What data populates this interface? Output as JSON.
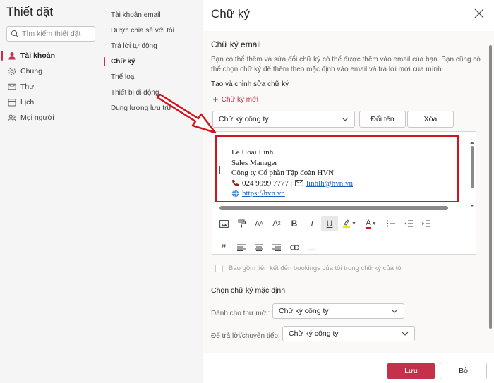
{
  "app": {
    "title": "Thiết đặt",
    "search_placeholder": "Tìm kiếm thiết đặt"
  },
  "nav": {
    "items": [
      {
        "label": "Tài khoản",
        "icon": "person-icon",
        "active": true
      },
      {
        "label": "Chung",
        "icon": "gear-icon",
        "active": false
      },
      {
        "label": "Thư",
        "icon": "mail-icon",
        "active": false
      },
      {
        "label": "Lịch",
        "icon": "calendar-icon",
        "active": false
      },
      {
        "label": "Mọi người",
        "icon": "people-icon",
        "active": false
      }
    ]
  },
  "subnav": {
    "items": [
      {
        "label": "Tài khoản email",
        "active": false
      },
      {
        "label": "Được chia sẻ với tôi",
        "active": false
      },
      {
        "label": "Trả lời tự động",
        "active": false
      },
      {
        "label": "Chữ ký",
        "active": true
      },
      {
        "label": "Thể loại",
        "active": false
      },
      {
        "label": "Thiết bị di động",
        "active": false
      },
      {
        "label": "Dung lượng lưu trữ",
        "active": false
      }
    ]
  },
  "dialog": {
    "title": "Chữ ký",
    "section_title": "Chữ ký email",
    "description": "Bạn có thể thêm và sửa đổi chữ ký có thể được thêm vào email của bạn. Bạn cũng có thể chọn chữ ký để thêm theo mặc định vào email và trả lời mới của mình.",
    "create_edit_heading": "Tạo và chỉnh sửa chữ ký",
    "new_signature_label": "Chữ ký mới",
    "selected_signature": "Chữ ký công ty",
    "rename_label": "Đổi tên",
    "delete_label": "Xóa"
  },
  "signature": {
    "name": "Lê Hoài Linh",
    "position": "Sales Manager",
    "company": "Công ty Cổ phần Tập đoàn HVN",
    "phone": "024 9999 7777 |",
    "email": "linhlh@hvn.vn",
    "website": "https://hvn.vn"
  },
  "toolbar": {
    "row1": [
      "image-icon",
      "format-painter-icon",
      "font-size-icon",
      "superscript-icon",
      "bold-icon",
      "italic-icon",
      "underline-icon",
      "highlight-icon",
      "font-color-icon",
      "bullet-list-icon",
      "decrease-indent-icon",
      "increase-indent-icon"
    ],
    "row2": [
      "quote-icon",
      "align-left-icon",
      "align-center-icon",
      "align-right-icon",
      "link-icon",
      "more-icon"
    ],
    "labels": {
      "font_size": "A",
      "superscript": "A",
      "bold": "B",
      "italic": "I",
      "underline": "U",
      "font_color": "A",
      "quote": "”",
      "more": "…"
    }
  },
  "bookings": {
    "label": "Bao gồm liên kết đến bookings của tôi trong chữ ký của tôi"
  },
  "defaults": {
    "title": "Chọn chữ ký mặc định",
    "new_messages_label": "Dành cho thư mới:",
    "new_messages_value": "Chữ ký công ty",
    "replies_label": "Để trả lời/chuyển tiếp:",
    "replies_value": "Chữ ký công ty"
  },
  "footer": {
    "save_label": "Lưu",
    "discard_label": "Bỏ"
  },
  "colors": {
    "accent": "#c4314b",
    "highlight_border": "#d4141d",
    "link": "#1f5fbf"
  }
}
